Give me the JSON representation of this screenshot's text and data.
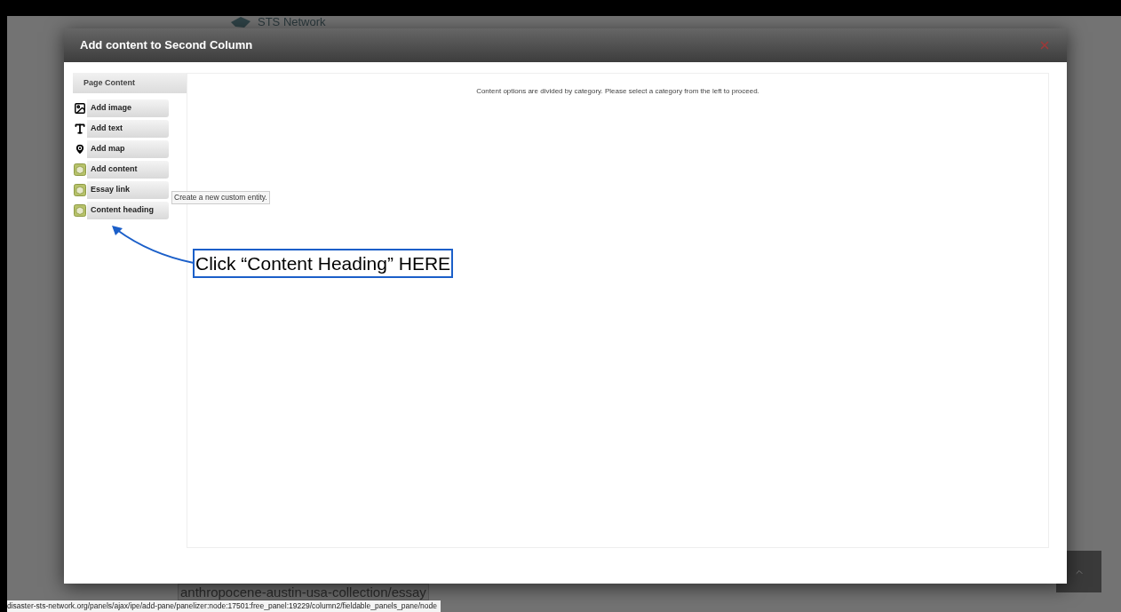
{
  "background": {
    "site_name": "STS Network",
    "path_text": "anthropocene-austin-usa-collection/essay"
  },
  "modal": {
    "title": "Add content to Second Column"
  },
  "sidebar": {
    "heading": "Page Content",
    "items": [
      {
        "label": "Add image",
        "kind": "image"
      },
      {
        "label": "Add text",
        "kind": "text"
      },
      {
        "label": "Add map",
        "kind": "map"
      },
      {
        "label": "Add content",
        "kind": "entity"
      },
      {
        "label": "Essay link",
        "kind": "entity"
      },
      {
        "label": "Content heading",
        "kind": "entity"
      }
    ]
  },
  "tooltip": "Create a new custom entity.",
  "message": "Content options are divided by category. Please select a category from the left to proceed.",
  "annotation": "Click “Content Heading” HERE",
  "status_bar": "disaster-sts-network.org/panels/ajax/ipe/add-pane/panelizer:node:17501:free_panel:19229/column2/fieldable_panels_pane/node"
}
